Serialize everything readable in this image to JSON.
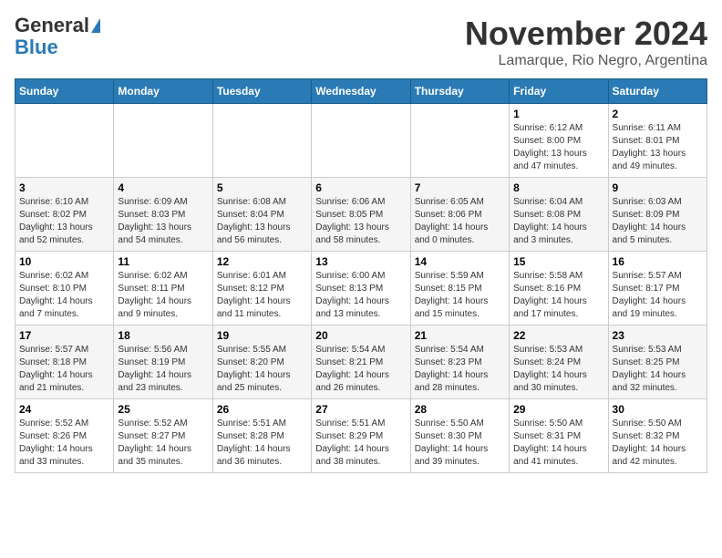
{
  "header": {
    "logo_line1": "General",
    "logo_line2": "Blue",
    "month_year": "November 2024",
    "location": "Lamarque, Rio Negro, Argentina"
  },
  "weekdays": [
    "Sunday",
    "Monday",
    "Tuesday",
    "Wednesday",
    "Thursday",
    "Friday",
    "Saturday"
  ],
  "weeks": [
    [
      {
        "day": "",
        "info": ""
      },
      {
        "day": "",
        "info": ""
      },
      {
        "day": "",
        "info": ""
      },
      {
        "day": "",
        "info": ""
      },
      {
        "day": "",
        "info": ""
      },
      {
        "day": "1",
        "info": "Sunrise: 6:12 AM\nSunset: 8:00 PM\nDaylight: 13 hours\nand 47 minutes."
      },
      {
        "day": "2",
        "info": "Sunrise: 6:11 AM\nSunset: 8:01 PM\nDaylight: 13 hours\nand 49 minutes."
      }
    ],
    [
      {
        "day": "3",
        "info": "Sunrise: 6:10 AM\nSunset: 8:02 PM\nDaylight: 13 hours\nand 52 minutes."
      },
      {
        "day": "4",
        "info": "Sunrise: 6:09 AM\nSunset: 8:03 PM\nDaylight: 13 hours\nand 54 minutes."
      },
      {
        "day": "5",
        "info": "Sunrise: 6:08 AM\nSunset: 8:04 PM\nDaylight: 13 hours\nand 56 minutes."
      },
      {
        "day": "6",
        "info": "Sunrise: 6:06 AM\nSunset: 8:05 PM\nDaylight: 13 hours\nand 58 minutes."
      },
      {
        "day": "7",
        "info": "Sunrise: 6:05 AM\nSunset: 8:06 PM\nDaylight: 14 hours\nand 0 minutes."
      },
      {
        "day": "8",
        "info": "Sunrise: 6:04 AM\nSunset: 8:08 PM\nDaylight: 14 hours\nand 3 minutes."
      },
      {
        "day": "9",
        "info": "Sunrise: 6:03 AM\nSunset: 8:09 PM\nDaylight: 14 hours\nand 5 minutes."
      }
    ],
    [
      {
        "day": "10",
        "info": "Sunrise: 6:02 AM\nSunset: 8:10 PM\nDaylight: 14 hours\nand 7 minutes."
      },
      {
        "day": "11",
        "info": "Sunrise: 6:02 AM\nSunset: 8:11 PM\nDaylight: 14 hours\nand 9 minutes."
      },
      {
        "day": "12",
        "info": "Sunrise: 6:01 AM\nSunset: 8:12 PM\nDaylight: 14 hours\nand 11 minutes."
      },
      {
        "day": "13",
        "info": "Sunrise: 6:00 AM\nSunset: 8:13 PM\nDaylight: 14 hours\nand 13 minutes."
      },
      {
        "day": "14",
        "info": "Sunrise: 5:59 AM\nSunset: 8:15 PM\nDaylight: 14 hours\nand 15 minutes."
      },
      {
        "day": "15",
        "info": "Sunrise: 5:58 AM\nSunset: 8:16 PM\nDaylight: 14 hours\nand 17 minutes."
      },
      {
        "day": "16",
        "info": "Sunrise: 5:57 AM\nSunset: 8:17 PM\nDaylight: 14 hours\nand 19 minutes."
      }
    ],
    [
      {
        "day": "17",
        "info": "Sunrise: 5:57 AM\nSunset: 8:18 PM\nDaylight: 14 hours\nand 21 minutes."
      },
      {
        "day": "18",
        "info": "Sunrise: 5:56 AM\nSunset: 8:19 PM\nDaylight: 14 hours\nand 23 minutes."
      },
      {
        "day": "19",
        "info": "Sunrise: 5:55 AM\nSunset: 8:20 PM\nDaylight: 14 hours\nand 25 minutes."
      },
      {
        "day": "20",
        "info": "Sunrise: 5:54 AM\nSunset: 8:21 PM\nDaylight: 14 hours\nand 26 minutes."
      },
      {
        "day": "21",
        "info": "Sunrise: 5:54 AM\nSunset: 8:23 PM\nDaylight: 14 hours\nand 28 minutes."
      },
      {
        "day": "22",
        "info": "Sunrise: 5:53 AM\nSunset: 8:24 PM\nDaylight: 14 hours\nand 30 minutes."
      },
      {
        "day": "23",
        "info": "Sunrise: 5:53 AM\nSunset: 8:25 PM\nDaylight: 14 hours\nand 32 minutes."
      }
    ],
    [
      {
        "day": "24",
        "info": "Sunrise: 5:52 AM\nSunset: 8:26 PM\nDaylight: 14 hours\nand 33 minutes."
      },
      {
        "day": "25",
        "info": "Sunrise: 5:52 AM\nSunset: 8:27 PM\nDaylight: 14 hours\nand 35 minutes."
      },
      {
        "day": "26",
        "info": "Sunrise: 5:51 AM\nSunset: 8:28 PM\nDaylight: 14 hours\nand 36 minutes."
      },
      {
        "day": "27",
        "info": "Sunrise: 5:51 AM\nSunset: 8:29 PM\nDaylight: 14 hours\nand 38 minutes."
      },
      {
        "day": "28",
        "info": "Sunrise: 5:50 AM\nSunset: 8:30 PM\nDaylight: 14 hours\nand 39 minutes."
      },
      {
        "day": "29",
        "info": "Sunrise: 5:50 AM\nSunset: 8:31 PM\nDaylight: 14 hours\nand 41 minutes."
      },
      {
        "day": "30",
        "info": "Sunrise: 5:50 AM\nSunset: 8:32 PM\nDaylight: 14 hours\nand 42 minutes."
      }
    ]
  ]
}
